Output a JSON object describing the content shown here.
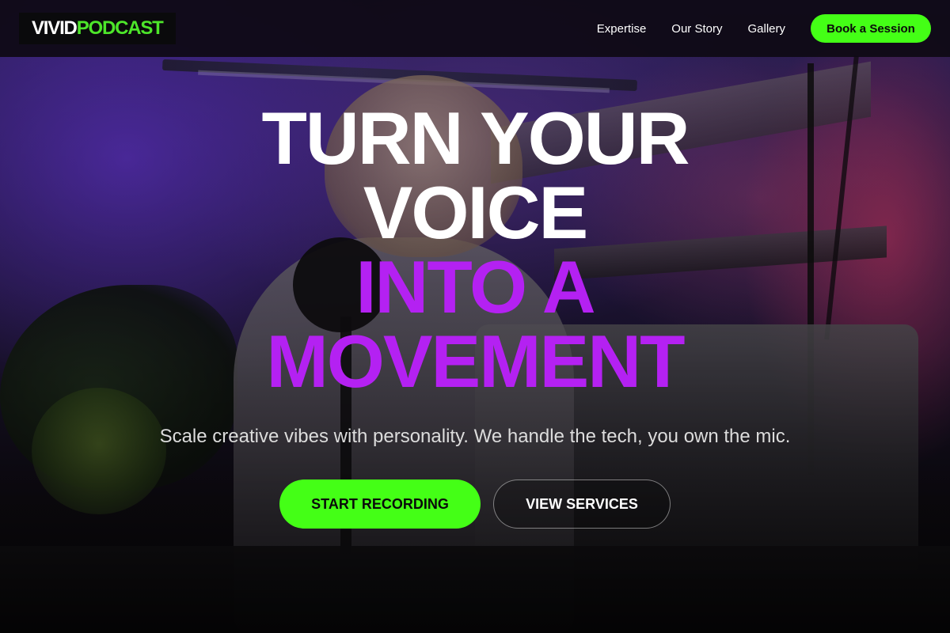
{
  "brand": {
    "logo_part1": "VIVID",
    "logo_part2": "PODCAST"
  },
  "nav": {
    "links": [
      "Expertise",
      "Our Story",
      "Gallery"
    ],
    "cta_label": "Book a Session"
  },
  "hero": {
    "headline_lines": [
      {
        "text": "TURN YOUR",
        "color": "white"
      },
      {
        "text": "VOICE",
        "color": "white"
      },
      {
        "text": "INTO A",
        "color": "purple"
      },
      {
        "text": "MOVEMENT",
        "color": "purple"
      }
    ],
    "subheadline": "Scale creative vibes with personality. We handle the tech, you own the mic.",
    "primary_cta": "START RECORDING",
    "secondary_cta": "VIEW SERVICES"
  },
  "colors": {
    "accent_green": "#44ff16",
    "headline_purple": "#b421f2",
    "nav_background": "#0e0a14"
  }
}
